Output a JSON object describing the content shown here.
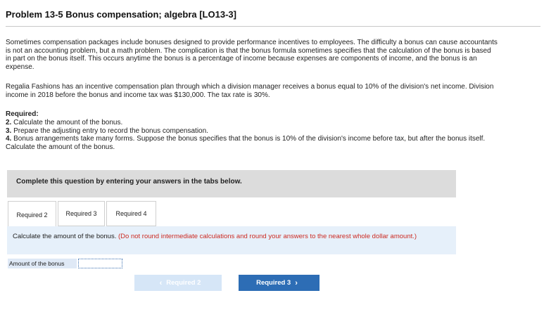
{
  "title": "Problem 13-5 Bonus compensation; algebra [LO13-3]",
  "paragraphs": {
    "p1": "Sometimes compensation packages include bonuses designed to provide performance incentives to employees. The difficulty a bonus can cause accountants is not an accounting problem, but a math problem. The complication is that the bonus formula sometimes specifies that the calculation of the bonus is based in part on the bonus itself. This occurs anytime the bonus is a percentage of income because expenses are components of income, and the bonus is an expense.",
    "p2": "Regalia Fashions has an incentive compensation plan through which a division manager receives a bonus equal to 10% of the division's net income. Division income in 2018 before the bonus and income tax was $130,000. The tax rate is 30%."
  },
  "required": {
    "heading": "Required:",
    "items": [
      {
        "num": "2.",
        "text": "Calculate the amount of the bonus."
      },
      {
        "num": "3.",
        "text": "Prepare the adjusting entry to record the bonus compensation."
      },
      {
        "num": "4.",
        "text": "Bonus arrangements take many forms. Suppose the bonus specifies that the bonus is 10% of the division's income before tax, but after the bonus itself. Calculate the amount of the bonus."
      }
    ]
  },
  "banner": "Complete this question by entering your answers in the tabs below.",
  "tabs": [
    {
      "label": "Required 2",
      "active": true
    },
    {
      "label": "Required 3",
      "active": false
    },
    {
      "label": "Required 4",
      "active": false
    }
  ],
  "instructions": {
    "main": "Calculate the amount of the bonus.",
    "note": "(Do not round intermediate calculations and round your answers to the nearest whole dollar amount.)"
  },
  "answer": {
    "label": "Amount of the bonus",
    "value": ""
  },
  "nav": {
    "prev_label": "Required 2",
    "next_label": "Required 3",
    "prev_icon": "chevron-left-icon",
    "next_icon": "chevron-right-icon"
  },
  "colors": {
    "banner_bg": "#dcdcdc",
    "panel_bg": "#e6f0fa",
    "note_red": "#cc2a22",
    "next_button": "#2d6db5",
    "prev_button_disabled": "#d6e6f7"
  }
}
